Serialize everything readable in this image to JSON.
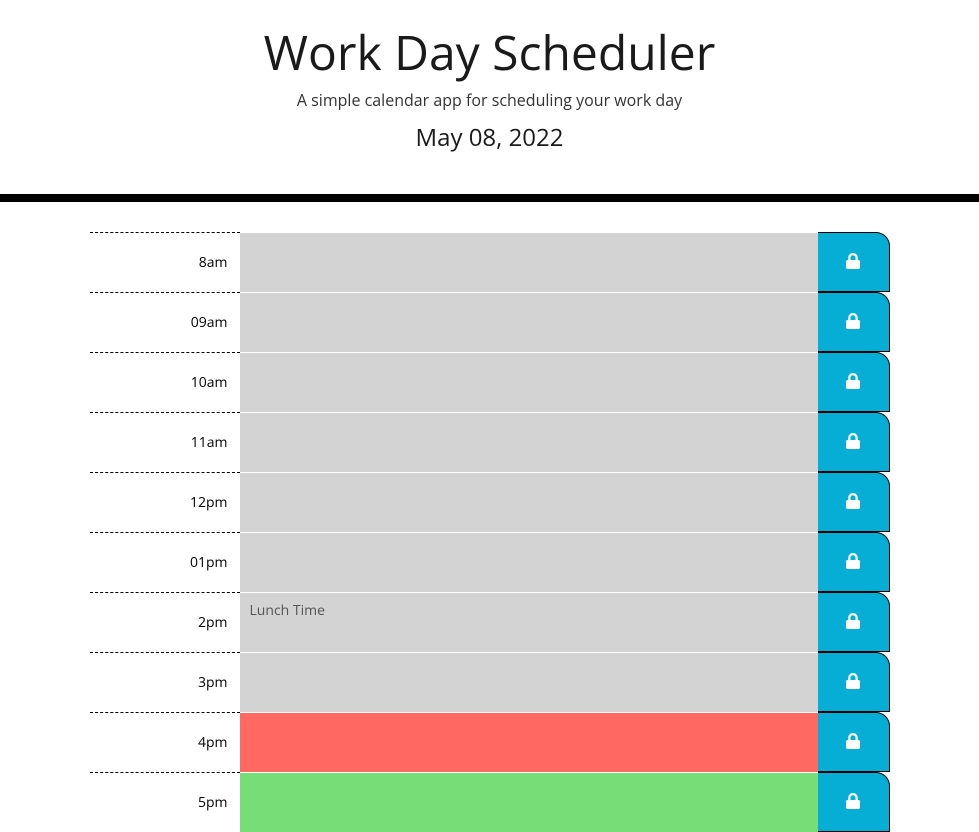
{
  "header": {
    "title": "Work Day Scheduler",
    "subtitle": "A simple calendar app for scheduling your work day",
    "current_date": "May 08, 2022"
  },
  "colors": {
    "accent": "#06aed5",
    "past": "#d3d3d3",
    "present": "#ff6961",
    "future": "#77dd77"
  },
  "rows": [
    {
      "label": "8am",
      "value": "",
      "state": "past"
    },
    {
      "label": "09am",
      "value": "",
      "state": "past"
    },
    {
      "label": "10am",
      "value": "",
      "state": "past"
    },
    {
      "label": "11am",
      "value": "",
      "state": "past"
    },
    {
      "label": "12pm",
      "value": "",
      "state": "past"
    },
    {
      "label": "01pm",
      "value": "",
      "state": "past"
    },
    {
      "label": "2pm",
      "value": "Lunch Time",
      "state": "past"
    },
    {
      "label": "3pm",
      "value": "",
      "state": "past"
    },
    {
      "label": "4pm",
      "value": "",
      "state": "present"
    },
    {
      "label": "5pm",
      "value": "",
      "state": "future"
    }
  ]
}
